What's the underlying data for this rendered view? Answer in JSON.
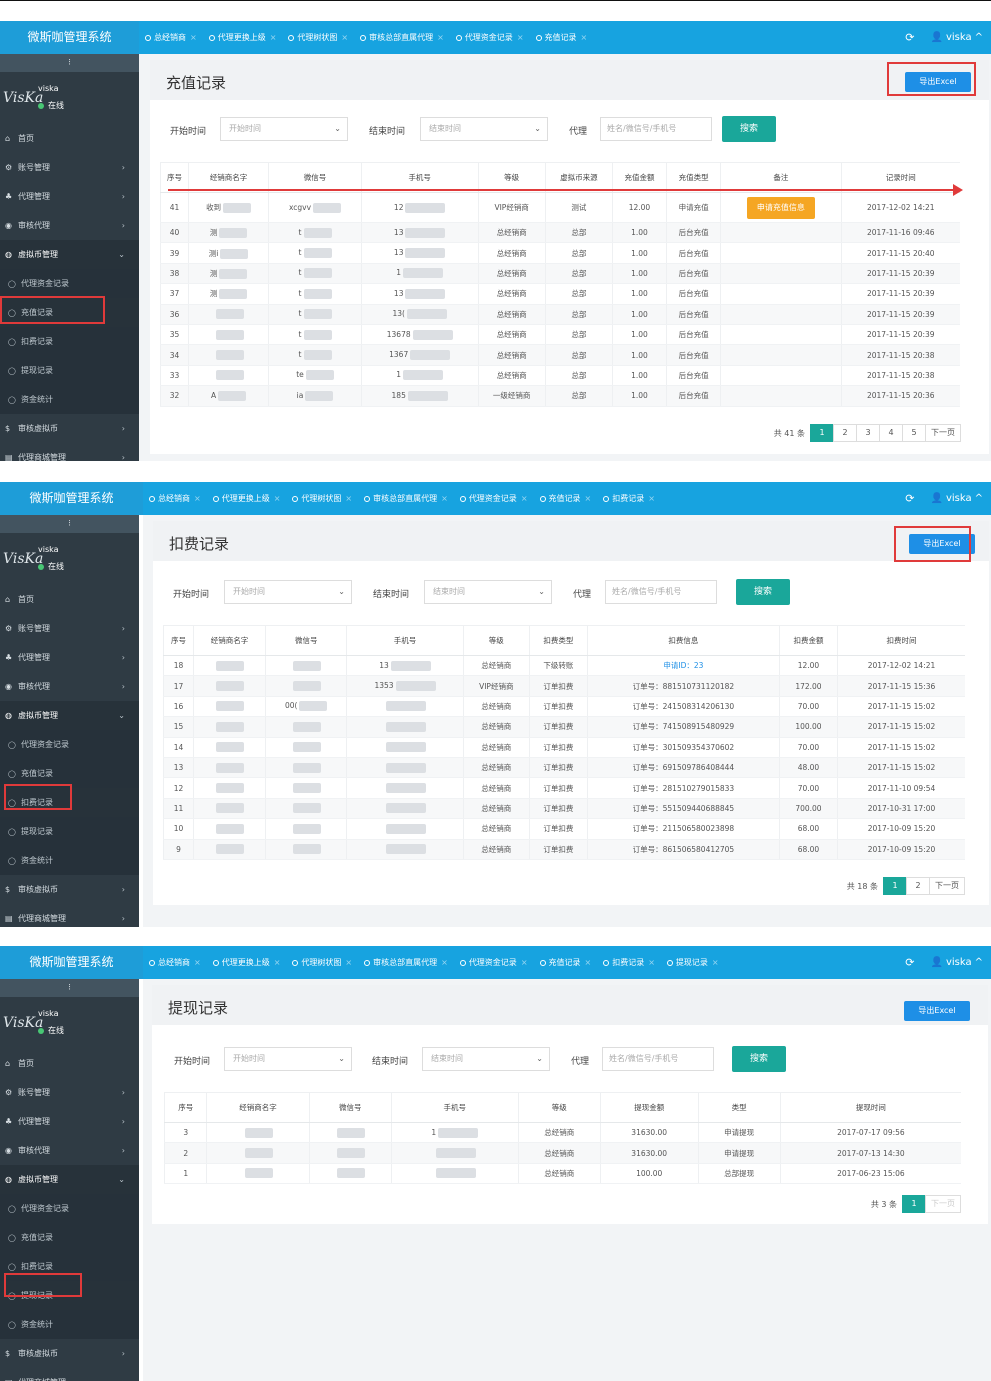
{
  "app": {
    "title": "微斯咖管理系统",
    "user": "viska",
    "status": "在线",
    "avatar_text": "VisKa"
  },
  "sidebar": {
    "toggle": "⁝",
    "items": [
      {
        "label": "首页",
        "icon": "home-icon"
      },
      {
        "label": "账号管理",
        "icon": "gears-icon"
      },
      {
        "label": "代理管理",
        "icon": "sitemap-icon"
      },
      {
        "label": "审核代理",
        "icon": "eye-icon"
      },
      {
        "label": "虚拟币管理",
        "icon": "coin-icon"
      }
    ],
    "submenu": [
      "代理资金记录",
      "充值记录",
      "扣费记录",
      "提现记录",
      "资金统计"
    ],
    "bottom": [
      "审核虚拟币",
      "代理商城管理"
    ]
  },
  "common": {
    "start_label": "开始时间",
    "start_placeholder": "开始时间",
    "end_label": "结束时间",
    "end_placeholder": "结束时间",
    "agent_label": "代理",
    "agent_placeholder": "姓名/微信号/手机号",
    "search": "搜索",
    "export": "导出Excel",
    "next": "下一页"
  },
  "panel1": {
    "tabs": [
      "总经销商",
      "代理更换上级",
      "代理树状图",
      "审核总部直属代理",
      "代理资金记录",
      "充值记录"
    ],
    "title": "充值记录",
    "columns": [
      "序号",
      "经销商名字",
      "微信号",
      "手机号",
      "等级",
      "虚拟币来源",
      "充值金额",
      "充值类型",
      "备注",
      "记录时间"
    ],
    "rows": [
      [
        "41",
        "收到",
        "xcgvv",
        "12",
        "VIP经销商",
        "测试",
        "12.00",
        "申请充值",
        "申请充值信息",
        "2017-12-02 14:21"
      ],
      [
        "40",
        "测",
        "t",
        "13",
        "总经销商",
        "总部",
        "1.00",
        "后台充值",
        "",
        "2017-11-16 09:46"
      ],
      [
        "39",
        "测i",
        "t",
        "13",
        "总经销商",
        "总部",
        "1.00",
        "后台充值",
        "",
        "2017-11-15 20:40"
      ],
      [
        "38",
        "测",
        "t",
        "1",
        "总经销商",
        "总部",
        "1.00",
        "后台充值",
        "",
        "2017-11-15 20:39"
      ],
      [
        "37",
        "测",
        "t",
        "13",
        "总经销商",
        "总部",
        "1.00",
        "后台充值",
        "",
        "2017-11-15 20:39"
      ],
      [
        "36",
        "",
        "t",
        "13(",
        "总经销商",
        "总部",
        "1.00",
        "后台充值",
        "",
        "2017-11-15 20:39"
      ],
      [
        "35",
        "",
        "t",
        "13678",
        "总经销商",
        "总部",
        "1.00",
        "后台充值",
        "",
        "2017-11-15 20:39"
      ],
      [
        "34",
        "",
        "t",
        "1367",
        "总经销商",
        "总部",
        "1.00",
        "后台充值",
        "",
        "2017-11-15 20:38"
      ],
      [
        "33",
        "",
        "te",
        "1",
        "总经销商",
        "总部",
        "1.00",
        "后台充值",
        "",
        "2017-11-15 20:38"
      ],
      [
        "32",
        "A",
        "ia",
        "185",
        "一级经销商",
        "总部",
        "1.00",
        "后台充值",
        "",
        "2017-11-15 20:36"
      ]
    ],
    "pager": {
      "total": "共 41 条",
      "pages": [
        "1",
        "2",
        "3",
        "4",
        "5"
      ]
    }
  },
  "panel2": {
    "tabs": [
      "总经销商",
      "代理更换上级",
      "代理树状图",
      "审核总部直属代理",
      "代理资金记录",
      "充值记录",
      "扣费记录"
    ],
    "title": "扣费记录",
    "columns": [
      "序号",
      "经销商名字",
      "微信号",
      "手机号",
      "等级",
      "扣费类型",
      "扣费信息",
      "扣费金额",
      "扣费时间"
    ],
    "rows": [
      [
        "18",
        "",
        "",
        "13",
        "总经销商",
        "下级转账",
        "申请ID：23",
        "12.00",
        "2017-12-02 14:21"
      ],
      [
        "17",
        "",
        "",
        "1353",
        "VIP经销商",
        "订单扣费",
        "订单号：881510731120182",
        "172.00",
        "2017-11-15 15:36"
      ],
      [
        "16",
        "",
        "00(",
        "",
        "总经销商",
        "订单扣费",
        "订单号：241508314206130",
        "70.00",
        "2017-11-15 15:02"
      ],
      [
        "15",
        "",
        "",
        "",
        "总经销商",
        "订单扣费",
        "订单号：741508915480929",
        "100.00",
        "2017-11-15 15:02"
      ],
      [
        "14",
        "",
        "",
        "",
        "总经销商",
        "订单扣费",
        "订单号：301509354370602",
        "70.00",
        "2017-11-15 15:02"
      ],
      [
        "13",
        "",
        "",
        "",
        "总经销商",
        "订单扣费",
        "订单号：691509786408444",
        "48.00",
        "2017-11-15 15:02"
      ],
      [
        "12",
        "",
        "",
        "",
        "总经销商",
        "订单扣费",
        "订单号：281510279015833",
        "70.00",
        "2017-11-10 09:54"
      ],
      [
        "11",
        "",
        "",
        "",
        "总经销商",
        "订单扣费",
        "订单号：551509440688845",
        "700.00",
        "2017-10-31 17:00"
      ],
      [
        "10",
        "",
        "",
        "",
        "总经销商",
        "订单扣费",
        "订单号：211506580023898",
        "68.00",
        "2017-10-09 15:20"
      ],
      [
        "9",
        "",
        "",
        "",
        "总经销商",
        "订单扣费",
        "订单号：861506580412705",
        "68.00",
        "2017-10-09 15:20"
      ]
    ],
    "pager": {
      "total": "共 18 条",
      "pages": [
        "1",
        "2"
      ]
    }
  },
  "panel3": {
    "tabs": [
      "总经销商",
      "代理更换上级",
      "代理树状图",
      "审核总部直属代理",
      "代理资金记录",
      "充值记录",
      "扣费记录",
      "提现记录"
    ],
    "title": "提现记录",
    "columns": [
      "序号",
      "经销商名字",
      "微信号",
      "手机号",
      "等级",
      "提现金额",
      "类型",
      "提现时间"
    ],
    "rows": [
      [
        "3",
        "",
        "",
        "1",
        "总经销商",
        "31630.00",
        "申请提现",
        "2017-07-17 09:56"
      ],
      [
        "2",
        "",
        "",
        "",
        "总经销商",
        "31630.00",
        "申请提现",
        "2017-07-13 14:30"
      ],
      [
        "1",
        "",
        "",
        "",
        "总经销商",
        "100.00",
        "总部提现",
        "2017-06-23 15:06"
      ]
    ],
    "pager": {
      "total": "共 3 条",
      "pages": [
        "1"
      ]
    }
  },
  "colors": {
    "brand": "#1e9dd8",
    "sidebar": "#2f3b44",
    "accent": "#1aa79a",
    "export": "#1e8fe6",
    "highlight": "#e03a3a",
    "apply": "#f5a623"
  }
}
